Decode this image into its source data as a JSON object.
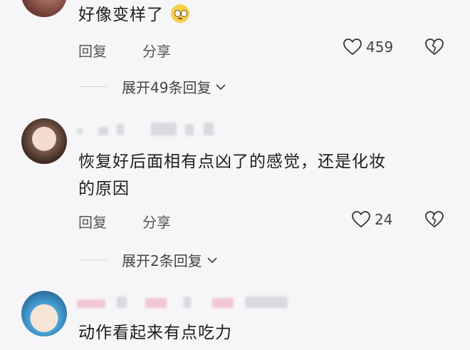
{
  "comments": [
    {
      "text": "好像变样了",
      "reply_label": "回复",
      "share_label": "分享",
      "likes": "459",
      "expand_label": "展开49条回复",
      "emoji_icon": "pleading-face-emoji"
    },
    {
      "text_line1": "恢复好后面相有点凶了的感觉，还是化妆",
      "text_line2": "的原因",
      "reply_label": "回复",
      "share_label": "分享",
      "likes": "24",
      "expand_label": "展开2条回复"
    },
    {
      "text": "动作看起来有点吃力"
    }
  ],
  "colors": {
    "background": "#f6f6f8",
    "text": "#1e1e1e",
    "secondary": "#555555"
  }
}
